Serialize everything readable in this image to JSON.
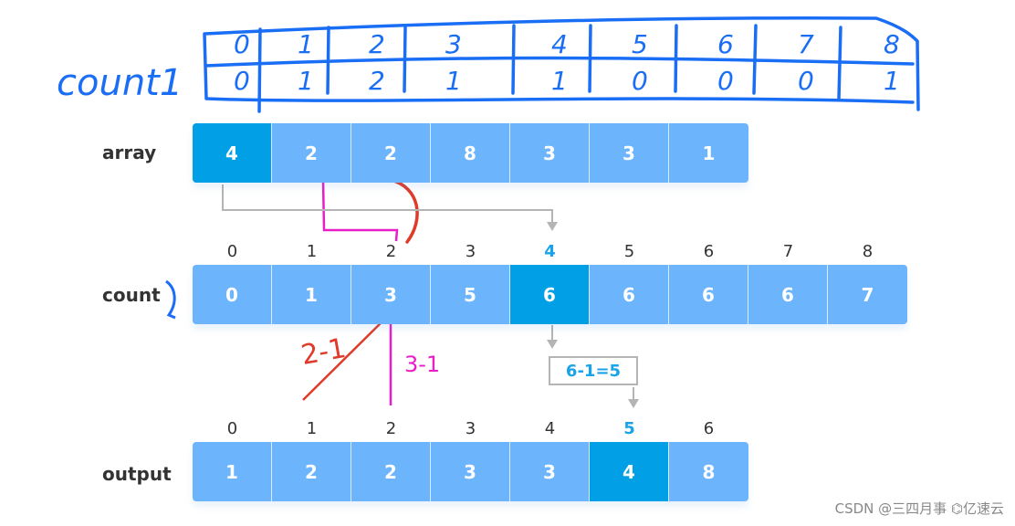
{
  "handwritten_table": {
    "title": "count1",
    "indices": [
      "0",
      "1",
      "2",
      "3",
      "4",
      "5",
      "6",
      "7",
      "8"
    ],
    "values": [
      "0",
      "1",
      "2",
      "1",
      "1",
      "0",
      "0",
      "0",
      "1"
    ],
    "color": "#1a6ef5"
  },
  "array": {
    "label": "array",
    "values": [
      "4",
      "2",
      "2",
      "8",
      "3",
      "3",
      "1"
    ],
    "highlight_index": 0
  },
  "count": {
    "label": "count",
    "indices": [
      "0",
      "1",
      "2",
      "3",
      "4",
      "5",
      "6",
      "7",
      "8"
    ],
    "values": [
      "0",
      "1",
      "3",
      "5",
      "6",
      "6",
      "6",
      "6",
      "7"
    ],
    "highlight_index": 4
  },
  "formula": "6-1=5",
  "annotations": {
    "red_note": "2-1",
    "magenta_note": "3-1"
  },
  "output": {
    "label": "output",
    "indices": [
      "0",
      "1",
      "2",
      "3",
      "4",
      "5",
      "6"
    ],
    "values": [
      "1",
      "2",
      "2",
      "3",
      "3",
      "4",
      "8"
    ],
    "highlight_index": 5
  },
  "colors": {
    "cell": "#6cb4fb",
    "cell_highlight": "#019fe6",
    "index_highlight": "#1aa3e8",
    "arrow": "#b4b4b4",
    "red_ink": "#e03a2a",
    "magenta_ink": "#e81ec8",
    "blue_ink": "#1a6ef5"
  },
  "watermark": "CSDN @三四月事  ⌬亿速云"
}
